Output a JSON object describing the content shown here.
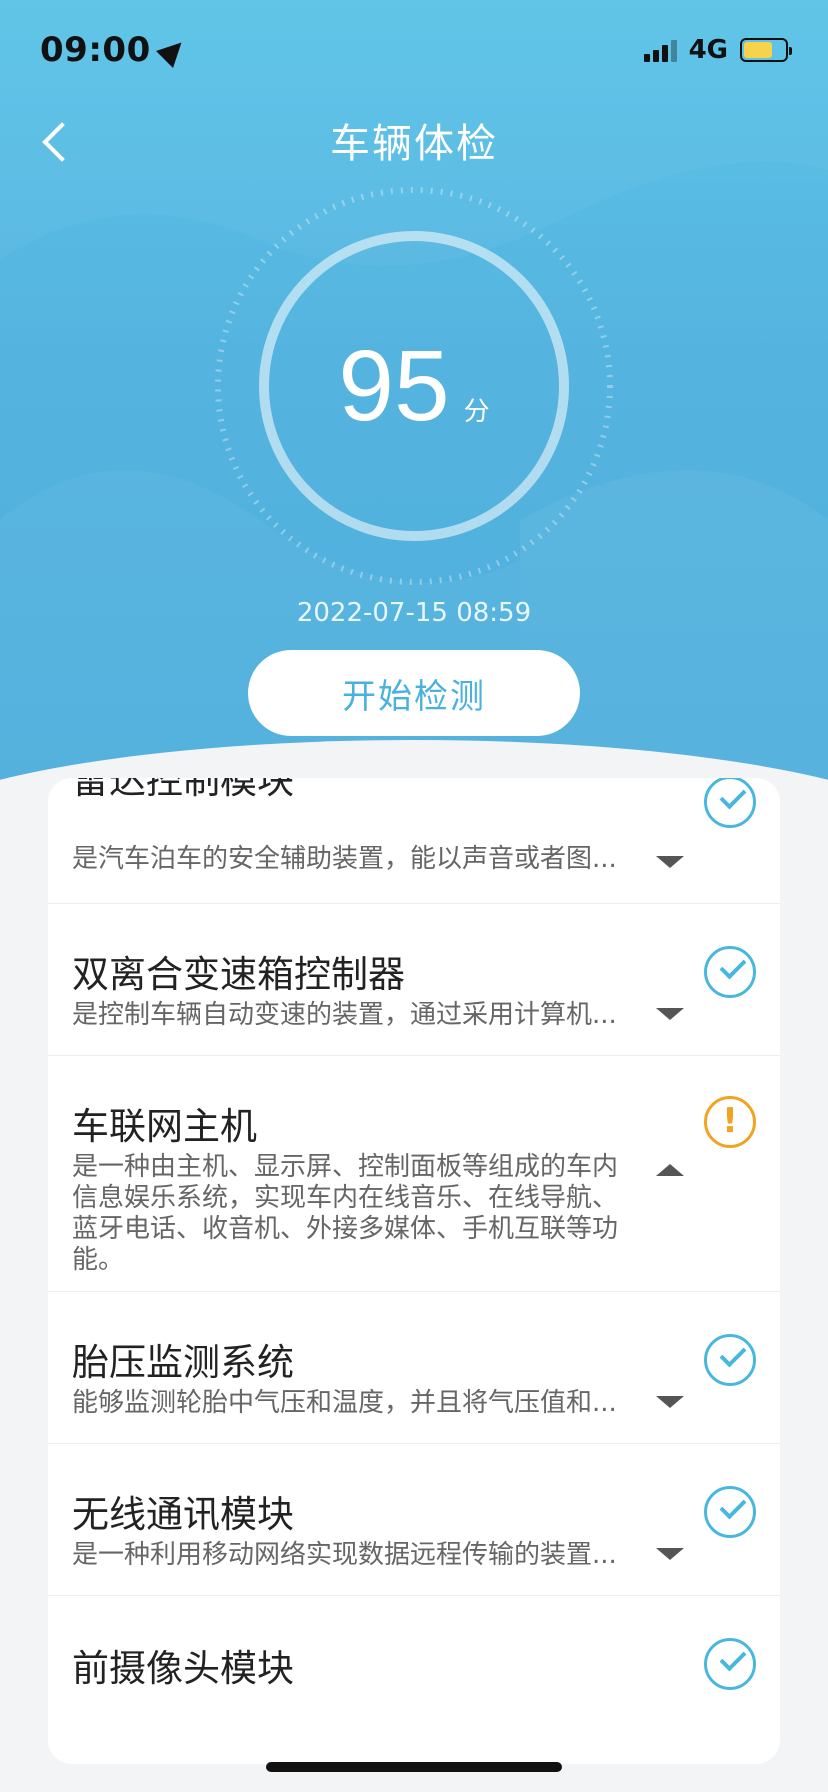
{
  "status": {
    "time": "09:00",
    "network": "4G"
  },
  "nav": {
    "title": "车辆体检"
  },
  "score": {
    "value": "95",
    "unit": "分",
    "date": "2022-07-15 08:59"
  },
  "actions": {
    "start": "开始检测"
  },
  "items": [
    {
      "title": "雷达控制模块",
      "desc": "是汽车泊车的安全辅助装置，能以声音或者图...",
      "status": "ok",
      "expanded": false
    },
    {
      "title": "双离合变速箱控制器",
      "desc": "是控制车辆自动变速的装置，通过采用计算机...",
      "status": "ok",
      "expanded": false
    },
    {
      "title": "车联网主机",
      "desc": "是一种由主机、显示屏、控制面板等组成的车内信息娱乐系统，实现车内在线音乐、在线导航、蓝牙电话、收音机、外接多媒体、手机互联等功能。",
      "status": "warning",
      "expanded": true
    },
    {
      "title": "胎压监测系统",
      "desc": "能够监测轮胎中气压和温度，并且将气压值和...",
      "status": "ok",
      "expanded": false
    },
    {
      "title": "无线通讯模块",
      "desc": "是一种利用移动网络实现数据远程传输的装置...",
      "status": "ok",
      "expanded": false
    },
    {
      "title": "前摄像头模块",
      "desc": "",
      "status": "ok",
      "expanded": false
    }
  ],
  "colors": {
    "accent": "#49b2dc",
    "warning": "#f2a321",
    "header_bg": "#55b4df"
  }
}
